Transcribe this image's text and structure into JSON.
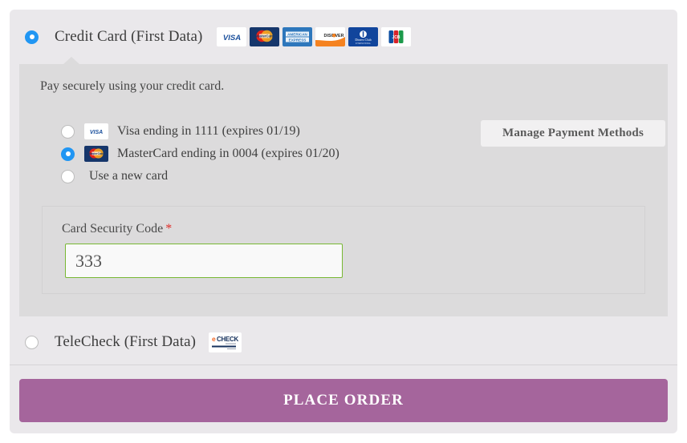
{
  "colors": {
    "card_bg": "#eae8eb",
    "panel_bg": "#dcdbdc",
    "radio_selected": "#2196f3",
    "input_valid_border": "#78b833",
    "required_star": "#e02b27",
    "place_order_bg": "#a5659c",
    "manage_btn_bg": "#f1f0f1"
  },
  "methods": [
    {
      "id": "credit-card",
      "label": "Credit Card (First Data)",
      "selected": true,
      "brands": [
        {
          "name": "visa-logo",
          "label": "VISA"
        },
        {
          "name": "mastercard-logo",
          "label": "MasterCard"
        },
        {
          "name": "amex-logo",
          "label": "AMERICAN EXPRESS"
        },
        {
          "name": "discover-logo",
          "label": "DISCOVER"
        },
        {
          "name": "diners-club-logo",
          "label": "Diners Club INTERNATIONAL"
        },
        {
          "name": "jcb-logo",
          "label": "JCB"
        }
      ]
    },
    {
      "id": "telecheck",
      "label": "TeleCheck (First Data)",
      "selected": false,
      "brands": [
        {
          "name": "echeck-logo",
          "label": "eCHECK"
        }
      ]
    }
  ],
  "panel": {
    "intro": "Pay securely using your credit card.",
    "saved_cards": [
      {
        "label": "Visa ending in 1111 (expires 01/19)",
        "logo": "visa-logo",
        "selected": false
      },
      {
        "label": "MasterCard ending in 0004 (expires 01/20)",
        "logo": "mastercard-logo",
        "selected": true
      },
      {
        "label": "Use a new card",
        "logo": null,
        "selected": false
      }
    ],
    "manage_button": "Manage Payment Methods",
    "cvv": {
      "label": "Card Security Code",
      "required_marker": "*",
      "value": "333",
      "placeholder": ""
    }
  },
  "footer": {
    "place_order_label": "PLACE ORDER"
  }
}
